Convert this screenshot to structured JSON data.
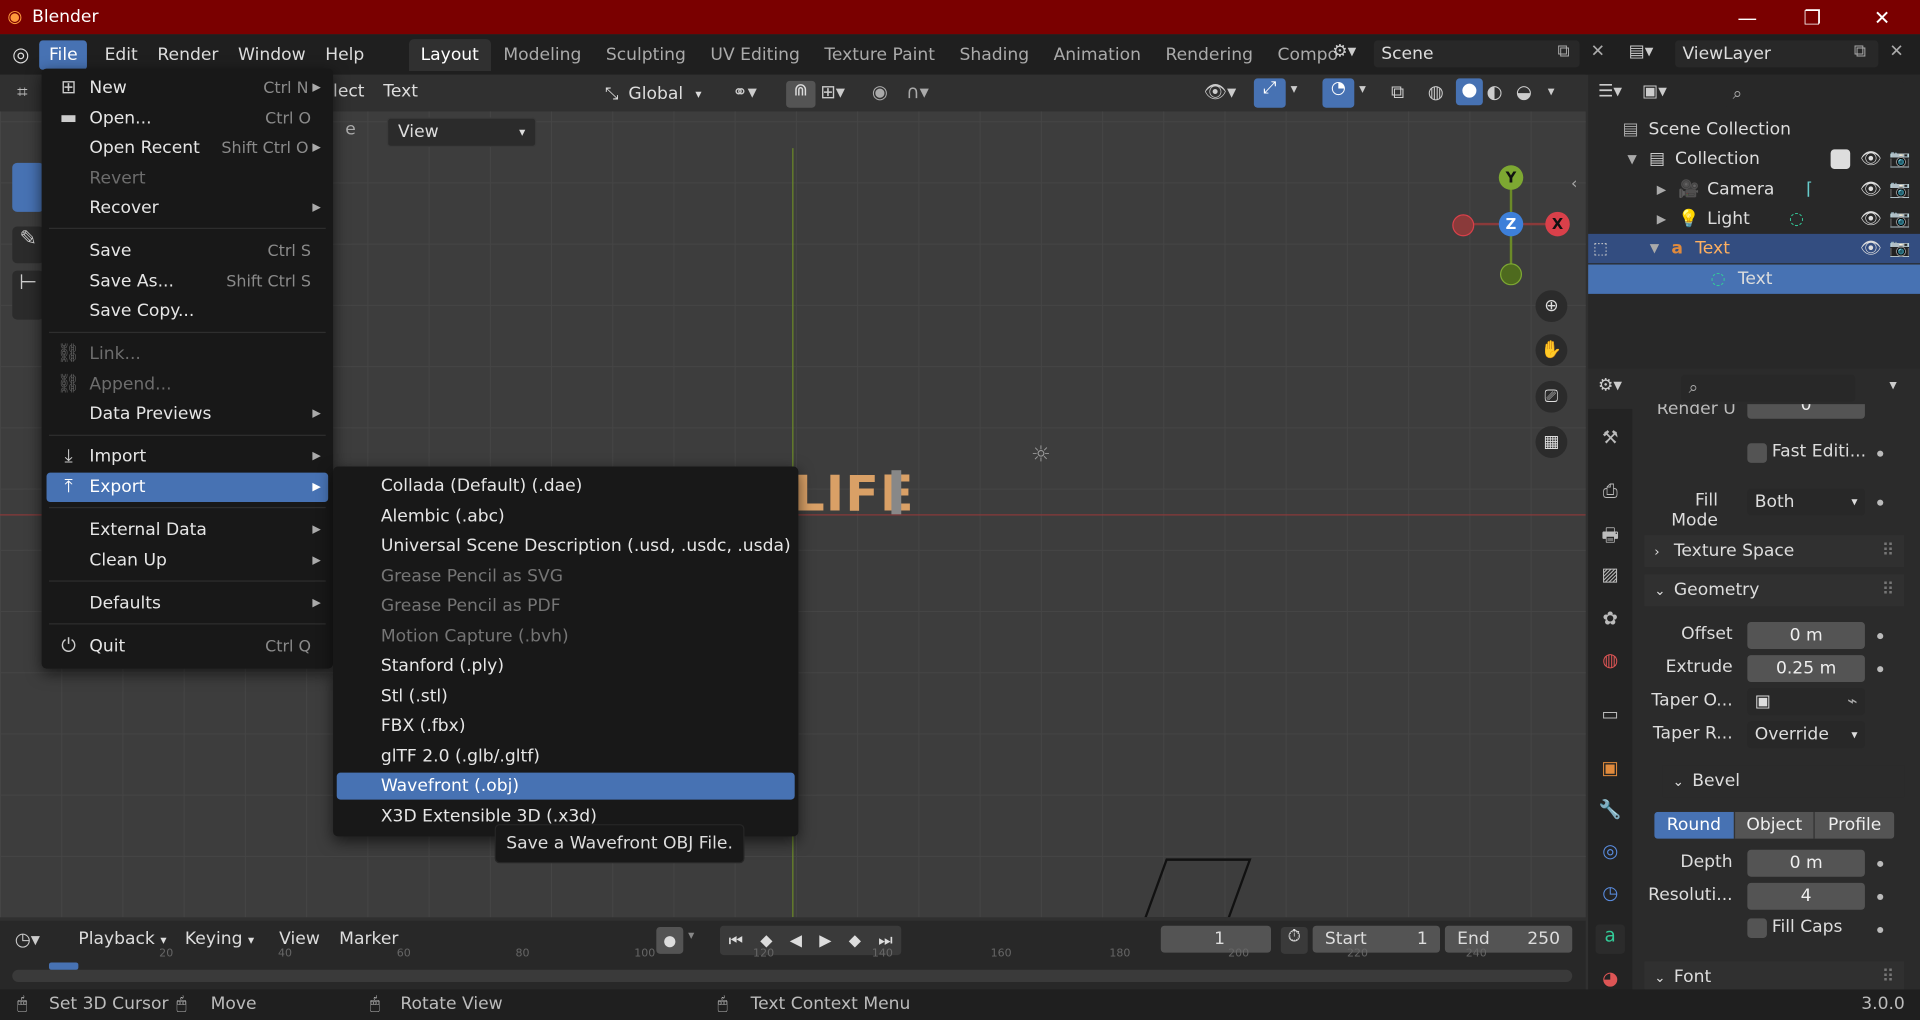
{
  "window": {
    "title": "Blender",
    "minimize": "—",
    "maximize": "❐",
    "close": "✕"
  },
  "menubar": {
    "file": "File",
    "edit": "Edit",
    "render": "Render",
    "window": "Window",
    "help": "Help"
  },
  "workspaces": [
    "Layout",
    "Modeling",
    "Sculpting",
    "UV Editing",
    "Texture Paint",
    "Shading",
    "Animation",
    "Rendering",
    "Compo"
  ],
  "scene": {
    "name": "Scene",
    "view_layer": "ViewLayer"
  },
  "viewport_header": {
    "select": "lect",
    "text_menu": "Text",
    "view_dropdown": "View",
    "orientation": "Global",
    "label_char": "e"
  },
  "viewport": {
    "text_object": "LIFE"
  },
  "gizmo": {
    "y": "Y",
    "z": "Z",
    "x": "X"
  },
  "file_menu": {
    "new": {
      "label": "New",
      "shortcut": "Ctrl N"
    },
    "open": {
      "label": "Open...",
      "shortcut": "Ctrl O"
    },
    "open_recent": {
      "label": "Open Recent",
      "shortcut": "Shift Ctrl O"
    },
    "revert": {
      "label": "Revert"
    },
    "recover": {
      "label": "Recover"
    },
    "save": {
      "label": "Save",
      "shortcut": "Ctrl S"
    },
    "save_as": {
      "label": "Save As...",
      "shortcut": "Shift Ctrl S"
    },
    "save_copy": {
      "label": "Save Copy..."
    },
    "link": {
      "label": "Link..."
    },
    "append": {
      "label": "Append..."
    },
    "data_previews": {
      "label": "Data Previews"
    },
    "import": {
      "label": "Import"
    },
    "export": {
      "label": "Export"
    },
    "external_data": {
      "label": "External Data"
    },
    "clean_up": {
      "label": "Clean Up"
    },
    "defaults": {
      "label": "Defaults"
    },
    "quit": {
      "label": "Quit",
      "shortcut": "Ctrl Q"
    }
  },
  "export_menu": [
    {
      "label": "Collada (Default) (.dae)",
      "enabled": true
    },
    {
      "label": "Alembic (.abc)",
      "enabled": true
    },
    {
      "label": "Universal Scene Description (.usd, .usdc, .usda)",
      "enabled": true
    },
    {
      "label": "Grease Pencil as SVG",
      "enabled": false
    },
    {
      "label": "Grease Pencil as PDF",
      "enabled": false
    },
    {
      "label": "Motion Capture (.bvh)",
      "enabled": false
    },
    {
      "label": "Stanford (.ply)",
      "enabled": true
    },
    {
      "label": "Stl (.stl)",
      "enabled": true
    },
    {
      "label": "FBX (.fbx)",
      "enabled": true
    },
    {
      "label": "glTF 2.0 (.glb/.gltf)",
      "enabled": true
    },
    {
      "label": "Wavefront (.obj)",
      "enabled": true,
      "highlighted": true
    },
    {
      "label": "X3D Extensible 3D (.x3d)",
      "enabled": true
    }
  ],
  "tooltip": "Save a Wavefront OBJ File.",
  "outliner": {
    "scene_collection": "Scene Collection",
    "collection": "Collection",
    "camera": "Camera",
    "light": "Light",
    "text": "Text",
    "text_data": "Text"
  },
  "properties": {
    "render_u_label": "Render U",
    "render_u_value": "0",
    "fast_editing": "Fast Editi...",
    "fill_mode_label": "Fill Mode",
    "fill_mode_value": "Both",
    "texture_space": "Texture Space",
    "geometry": "Geometry",
    "offset_label": "Offset",
    "offset_value": "0 m",
    "extrude_label": "Extrude",
    "extrude_value": "0.25 m",
    "taper_object_label": "Taper O...",
    "taper_radius_label": "Taper R...",
    "taper_radius_value": "Override",
    "bevel": "Bevel",
    "bevel_modes": [
      "Round",
      "Object",
      "Profile"
    ],
    "depth_label": "Depth",
    "depth_value": "0 m",
    "resolution_label": "Resoluti...",
    "resolution_value": "4",
    "fill_caps": "Fill Caps",
    "font": "Font"
  },
  "timeline": {
    "playback": "Playback",
    "keying": "Keying",
    "view": "View",
    "marker": "Marker",
    "current_frame": "1",
    "start_label": "Start",
    "start_value": "1",
    "end_label": "End",
    "end_value": "250",
    "ruler": [
      "20",
      "40",
      "60",
      "80",
      "100",
      "120",
      "140",
      "160",
      "180",
      "200",
      "220",
      "240"
    ]
  },
  "statusbar": {
    "set_cursor": "Set 3D Cursor",
    "move": "Move",
    "rotate": "Rotate View",
    "context_menu": "Text Context Menu",
    "version": "3.0.0"
  },
  "colors": {
    "title_bar": "#7a0000",
    "highlight": "#4772b3",
    "text_object": "#d9a066"
  }
}
